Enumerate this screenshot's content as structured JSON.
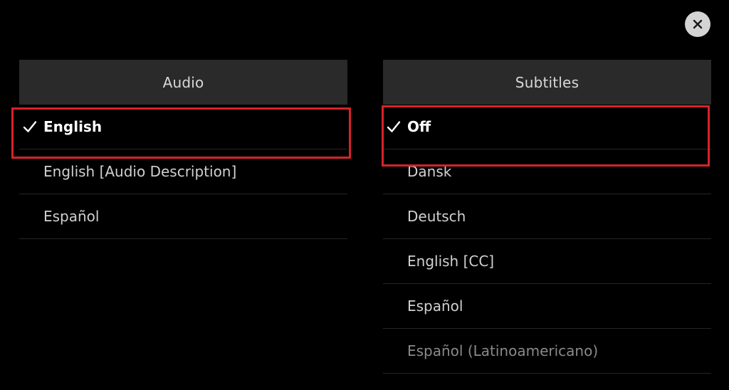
{
  "close_button": {
    "icon": "close-icon"
  },
  "audio": {
    "title": "Audio",
    "options": [
      {
        "label": "English",
        "selected": true
      },
      {
        "label": "English [Audio Description]",
        "selected": false
      },
      {
        "label": "Español",
        "selected": false
      }
    ]
  },
  "subtitles": {
    "title": "Subtitles",
    "options": [
      {
        "label": "Off",
        "selected": true
      },
      {
        "label": "Dansk",
        "selected": false
      },
      {
        "label": "Deutsch",
        "selected": false
      },
      {
        "label": "English [CC]",
        "selected": false
      },
      {
        "label": "Español",
        "selected": false
      },
      {
        "label": "Español (Latinoamericano)",
        "selected": false
      }
    ]
  },
  "colors": {
    "background": "#000000",
    "header_bg": "#2a2a2a",
    "highlight": "#d8222a",
    "close_bg": "#d4d4d4"
  }
}
